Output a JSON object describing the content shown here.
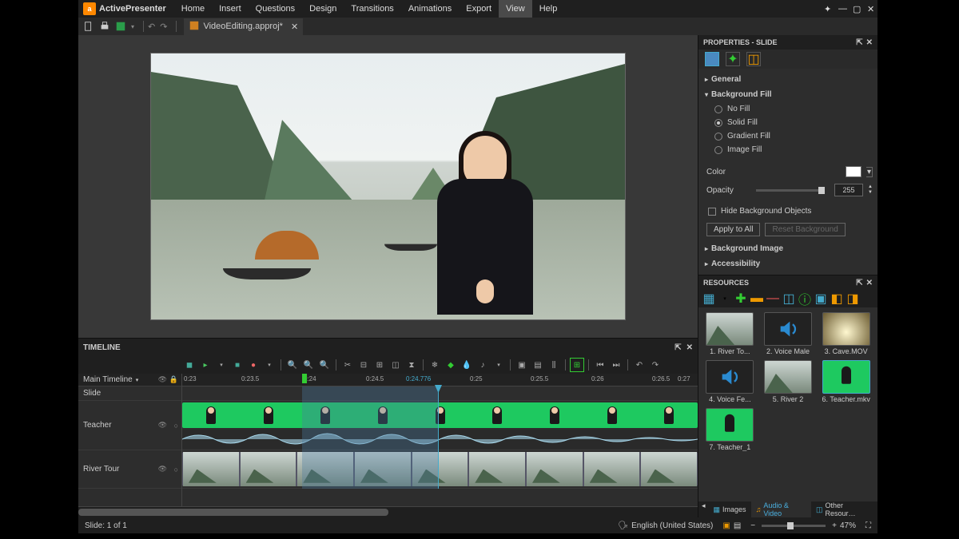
{
  "app": {
    "brand": "ActivePresenter"
  },
  "menu": [
    "Home",
    "Insert",
    "Questions",
    "Design",
    "Transitions",
    "Animations",
    "Export",
    "View",
    "Help"
  ],
  "menu_active_index": 7,
  "doc": {
    "name": "VideoEditing.approj*",
    "close": "✕"
  },
  "properties": {
    "title": "PROPERTIES - SLIDE",
    "sections": {
      "general": "General",
      "bgfill": "Background Fill",
      "bgimage": "Background Image",
      "access": "Accessibility"
    },
    "fill_options": {
      "none": "No Fill",
      "solid": "Solid Fill",
      "gradient": "Gradient Fill",
      "image": "Image Fill"
    },
    "labels": {
      "color": "Color",
      "opacity": "Opacity",
      "hidebg": "Hide Background Objects"
    },
    "values": {
      "opacity": "255"
    },
    "buttons": {
      "apply": "Apply to All",
      "reset": "Reset Background"
    }
  },
  "resources": {
    "title": "RESOURCES",
    "items": [
      {
        "name": "1. River To...",
        "kind": "landscape"
      },
      {
        "name": "2. Voice Male",
        "kind": "speaker"
      },
      {
        "name": "3. Cave.MOV",
        "kind": "cave"
      },
      {
        "name": "4. Voice Fe...",
        "kind": "speaker"
      },
      {
        "name": "5. River 2",
        "kind": "landscape"
      },
      {
        "name": "6. Teacher.mkv",
        "kind": "green",
        "selected": true
      },
      {
        "name": "7. Teacher_1",
        "kind": "green"
      }
    ],
    "tabs": {
      "images": "Images",
      "av": "Audio & Video",
      "other": "Other Resour…"
    }
  },
  "timeline": {
    "title": "TIMELINE",
    "label_main": "Main Timeline",
    "tracks": {
      "slide": "Slide",
      "teacher": "Teacher",
      "river": "River Tour"
    },
    "ticks": [
      "0:23",
      "0:23.5",
      "0:24",
      "0:24.5",
      "0:24.776",
      "0:25",
      "0:25.5",
      "0:26",
      "0:26.5",
      "0:27"
    ]
  },
  "status": {
    "slide": "Slide: 1 of 1",
    "lang": "English (United States)",
    "zoom": "47%",
    "minus": "−",
    "plus": "+"
  }
}
